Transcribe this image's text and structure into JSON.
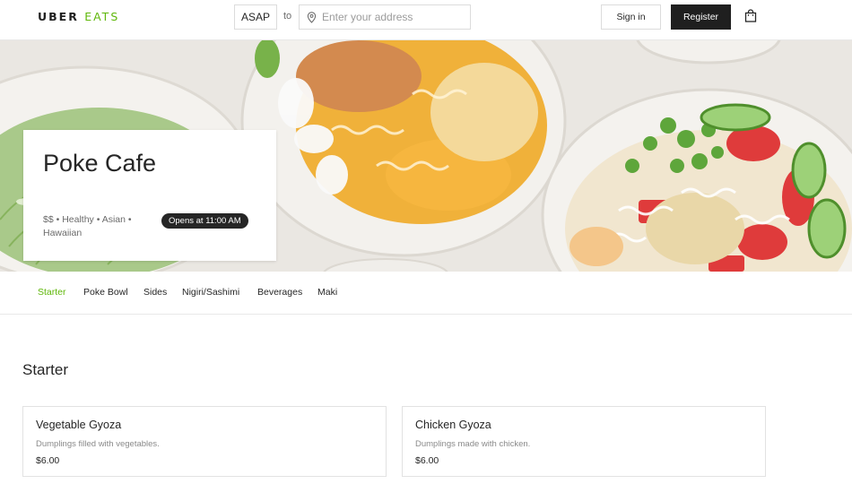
{
  "header": {
    "logo_main": "UBER",
    "logo_sub": "EATS",
    "time_label": "ASAP",
    "to_label": "to",
    "address_placeholder": "Enter your address",
    "address_value": "",
    "signin_label": "Sign in",
    "register_label": "Register",
    "icons": {
      "address": "location-pin-icon",
      "cart": "shopping-bag-icon"
    }
  },
  "restaurant": {
    "name": "Poke Cafe",
    "tags": "$$ • Healthy • Asian • Hawaiian",
    "opens": "Opens at 11:00 AM"
  },
  "categories": [
    {
      "label": "Starter",
      "active": true
    },
    {
      "label": "Poke Bowl",
      "active": false
    },
    {
      "label": "Sides",
      "active": false
    },
    {
      "label": "Nigiri/Sashimi",
      "active": false
    },
    {
      "label": "Beverages",
      "active": false
    },
    {
      "label": "Maki",
      "active": false
    }
  ],
  "section": {
    "title": "Starter",
    "items": [
      {
        "name": "Vegetable Gyoza",
        "description": "Dumplings filled with vegetables.",
        "price": "$6.00"
      },
      {
        "name": "Chicken Gyoza",
        "description": "Dumplings made with chicken.",
        "price": "$6.00"
      }
    ]
  },
  "colors": {
    "accent": "#5fb709",
    "dark": "#1f1f1f",
    "border": "#e2e2e2"
  }
}
